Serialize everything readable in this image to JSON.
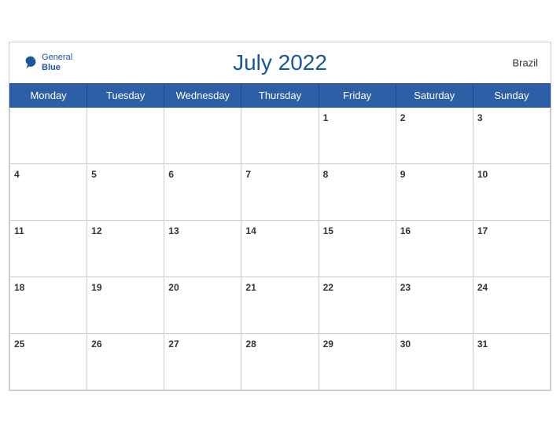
{
  "header": {
    "title": "July 2022",
    "country": "Brazil",
    "logo_general": "General",
    "logo_blue": "Blue"
  },
  "days_of_week": [
    "Monday",
    "Tuesday",
    "Wednesday",
    "Thursday",
    "Friday",
    "Saturday",
    "Sunday"
  ],
  "weeks": [
    [
      null,
      null,
      null,
      null,
      1,
      2,
      3
    ],
    [
      4,
      5,
      6,
      7,
      8,
      9,
      10
    ],
    [
      11,
      12,
      13,
      14,
      15,
      16,
      17
    ],
    [
      18,
      19,
      20,
      21,
      22,
      23,
      24
    ],
    [
      25,
      26,
      27,
      28,
      29,
      30,
      31
    ]
  ]
}
